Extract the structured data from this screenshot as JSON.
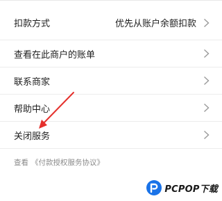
{
  "menu": {
    "items": [
      {
        "label": "扣款方式",
        "value": "优先从账户余额扣款"
      },
      {
        "label": "查看在此商户的账单",
        "value": ""
      },
      {
        "label": "联系商家",
        "value": ""
      },
      {
        "label": "帮助中心",
        "value": ""
      },
      {
        "label": "关闭服务",
        "value": ""
      }
    ]
  },
  "footer": {
    "prefix": "查看",
    "link": "《付款授权服务协议》"
  },
  "watermark": {
    "brand": "PCPOP下载",
    "logo_icon": "pcpop-logo-icon",
    "logo_color": "#1a73e8"
  },
  "annotation": {
    "arrow_color": "#e5302c"
  }
}
